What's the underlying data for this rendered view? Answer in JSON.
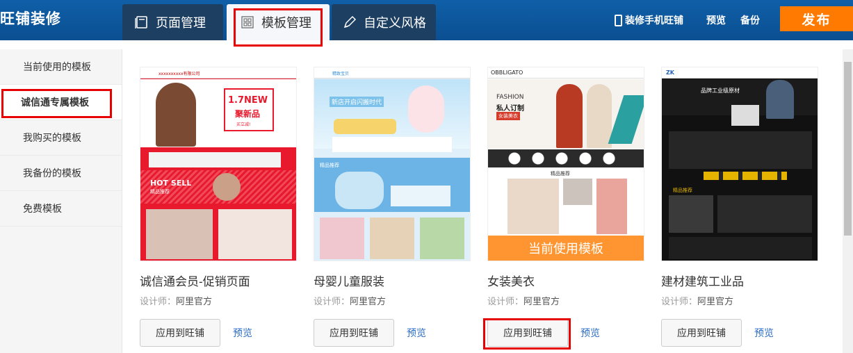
{
  "app": {
    "title": "旺铺装修"
  },
  "tabs": [
    {
      "label": "页面管理"
    },
    {
      "label": "模板管理"
    },
    {
      "label": "自定义风格"
    }
  ],
  "toolbar": {
    "mobile_label": "装修手机旺铺",
    "preview_label": "预览",
    "backup_label": "备份",
    "publish_label": "发布"
  },
  "sidebar": {
    "items": [
      {
        "label": "当前使用的模板"
      },
      {
        "label": "诚信通专属模板"
      },
      {
        "label": "我购买的模板"
      },
      {
        "label": "我备份的模板"
      },
      {
        "label": "免费模板"
      }
    ],
    "active_index": 1
  },
  "templates": [
    {
      "name": "诚信通会员-促销页面",
      "designer_label": "设计师：",
      "designer": "阿里官方",
      "apply_label": "应用到旺铺",
      "preview_label": "预览",
      "thumb_text": {
        "shop": "xxxxxxxxxx有限公司",
        "headline": "1.7NEW",
        "sub": "聚新品",
        "cta": "买立减!",
        "sale": "HOT SELL",
        "sale_sub": "精品推荐"
      }
    },
    {
      "name": "母婴儿童服装",
      "designer_label": "设计师：",
      "designer": "阿里官方",
      "apply_label": "应用到旺铺",
      "preview_label": "预览",
      "thumb_text": {
        "shop": "精致宝贝",
        "headline": "新店开启闪搬时代",
        "section": "精品推荐"
      }
    },
    {
      "name": "女装美衣",
      "designer_label": "设计师：",
      "designer": "阿里官方",
      "apply_label": "应用到旺铺",
      "preview_label": "预览",
      "current_label": "当前使用模板",
      "thumb_text": {
        "shop": "OBBLIGATO",
        "headline": "FASHION",
        "sub": "私人订制",
        "sub2": "女装美衣",
        "section": "精品推荐"
      }
    },
    {
      "name": "建材建筑工业品",
      "designer_label": "设计师：",
      "designer": "阿里官方",
      "apply_label": "应用到旺铺",
      "preview_label": "预览",
      "thumb_text": {
        "shop": "ZK",
        "headline": "品牌工业级原材",
        "section": "精品推荐"
      }
    }
  ],
  "colors": {
    "topbar": "#0b4f91",
    "publish": "#ff7a00",
    "highlight": "#e60000",
    "link": "#2b6cc4"
  }
}
